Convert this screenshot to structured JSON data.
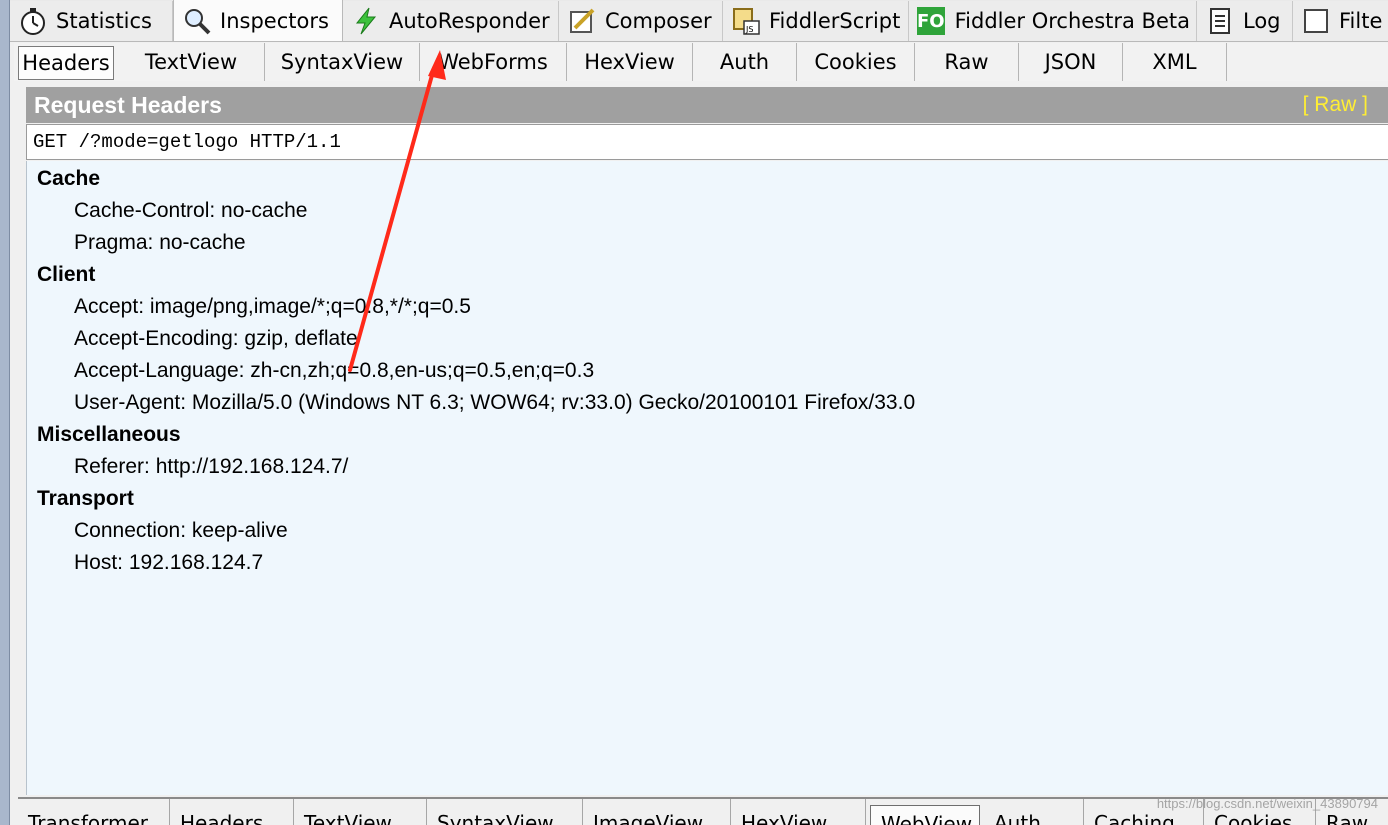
{
  "top_tabs": [
    {
      "label": "Statistics",
      "icon": "stopwatch-icon"
    },
    {
      "label": "Inspectors",
      "icon": "magnifier-icon",
      "active": true
    },
    {
      "label": "AutoResponder",
      "icon": "lightning-icon"
    },
    {
      "label": "Composer",
      "icon": "pencil-icon"
    },
    {
      "label": "FiddlerScript",
      "icon": "script-icon"
    },
    {
      "label": "Fiddler Orchestra Beta",
      "icon": "fo-icon",
      "badge": "FO"
    },
    {
      "label": "Log",
      "icon": "log-icon"
    },
    {
      "label": "Filte",
      "icon": "checkbox-icon"
    }
  ],
  "sub_tabs": [
    "Headers",
    "TextView",
    "SyntaxView",
    "WebForms",
    "HexView",
    "Auth",
    "Cookies",
    "Raw",
    "JSON",
    "XML"
  ],
  "request_headers": {
    "title": "Request Headers",
    "raw_link": "[ Raw ]",
    "request_line": "GET /?mode=getlogo HTTP/1.1",
    "groups": [
      {
        "name": "Cache",
        "items": [
          "Cache-Control: no-cache",
          "Pragma: no-cache"
        ]
      },
      {
        "name": "Client",
        "items": [
          "Accept: image/png,image/*;q=0.8,*/*;q=0.5",
          "Accept-Encoding: gzip, deflate",
          "Accept-Language: zh-cn,zh;q=0.8,en-us;q=0.5,en;q=0.3",
          "User-Agent: Mozilla/5.0 (Windows NT 6.3; WOW64; rv:33.0) Gecko/20100101 Firefox/33.0"
        ]
      },
      {
        "name": "Miscellaneous",
        "items": [
          "Referer: http://192.168.124.7/"
        ]
      },
      {
        "name": "Transport",
        "items": [
          "Connection: keep-alive",
          "Host: 192.168.124.7"
        ]
      }
    ]
  },
  "bottom_tabs": [
    "Transformer",
    "Headers",
    "TextView",
    "SyntaxView",
    "ImageView",
    "HexView",
    "WebView",
    "Auth",
    "Caching",
    "Cookies",
    "Raw"
  ],
  "watermark": "https://blog.csdn.net/weixin_43890794",
  "colors": {
    "annotation_arrow": "#ff2a1a",
    "raw_link": "#ffee33",
    "panel_bg": "#eff7fd",
    "header_bar": "#a0a0a0"
  }
}
